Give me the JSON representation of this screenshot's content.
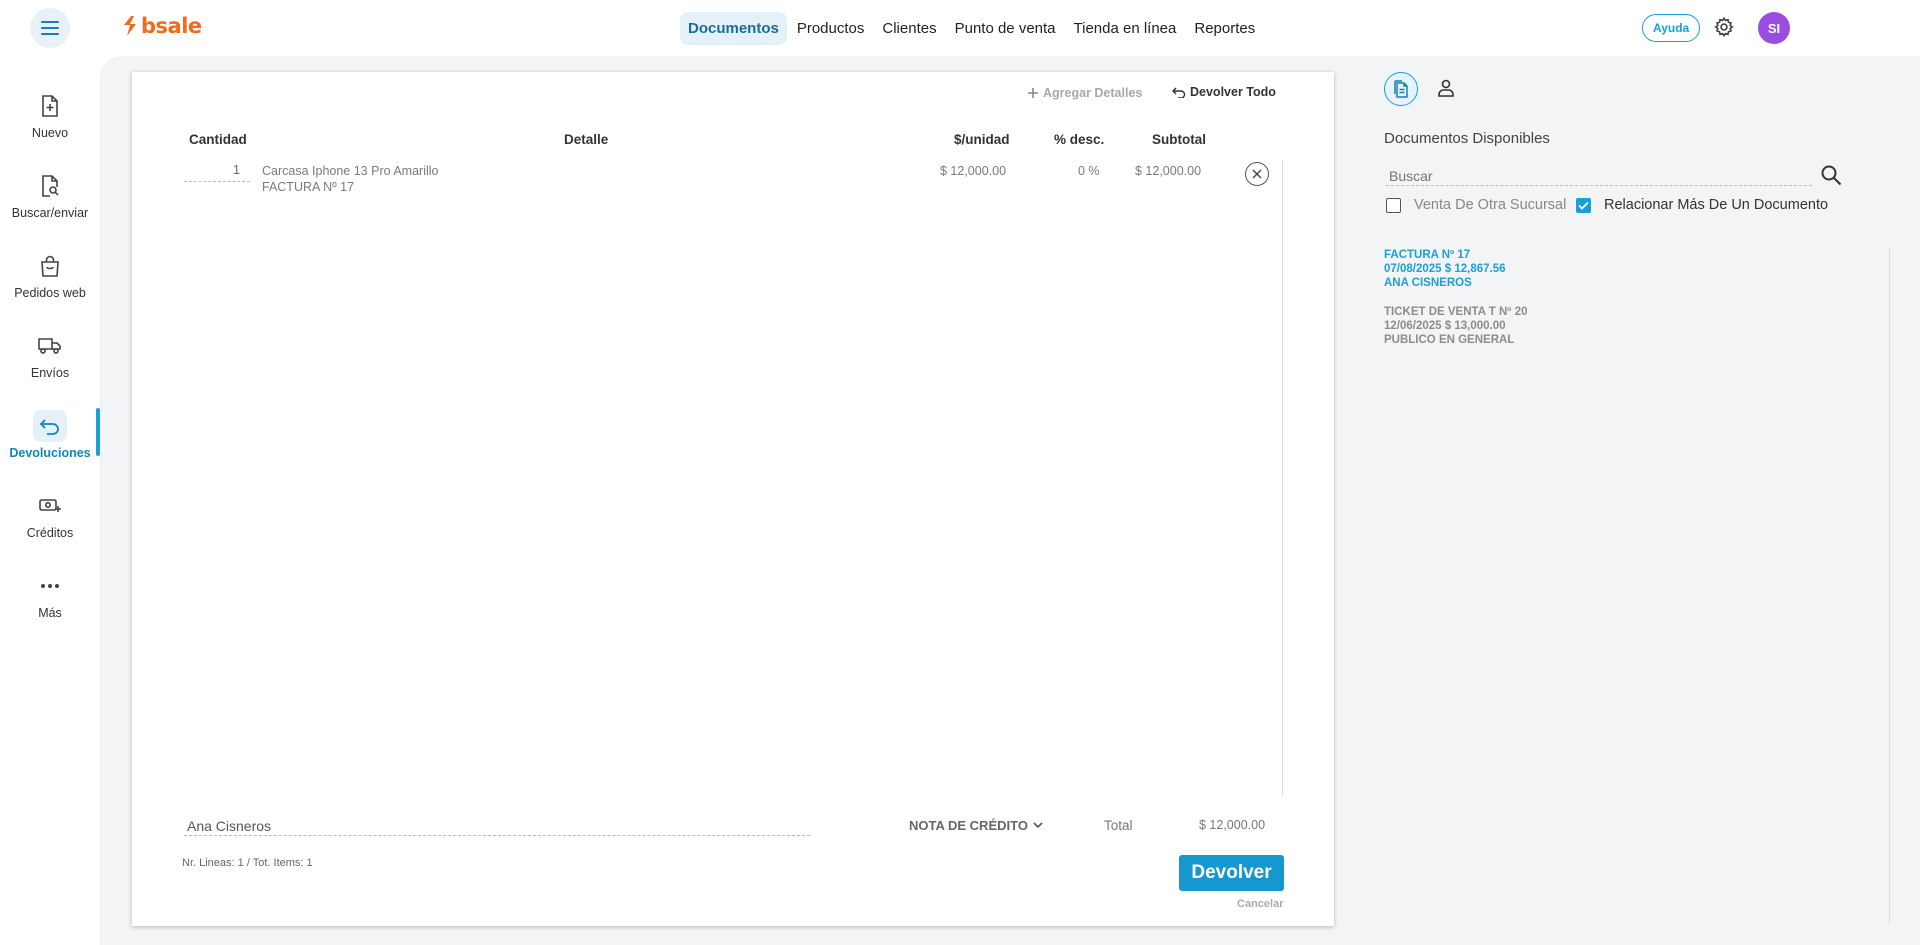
{
  "app": {
    "logo_text": "bsale",
    "brand_color": "#f26b1d",
    "accent_color": "#1a9fd6"
  },
  "topnav": {
    "items": [
      {
        "label": "Documentos",
        "active": true
      },
      {
        "label": "Productos"
      },
      {
        "label": "Clientes"
      },
      {
        "label": "Punto de venta"
      },
      {
        "label": "Tienda en línea"
      },
      {
        "label": "Reportes"
      }
    ],
    "help_label": "Ayuda",
    "avatar_initials": "SI",
    "avatar_color": "#9b4de2"
  },
  "sidebar": {
    "items": [
      {
        "label": "Nuevo",
        "icon": "file-plus-icon"
      },
      {
        "label": "Buscar/enviar",
        "icon": "file-search-icon"
      },
      {
        "label": "Pedidos web",
        "icon": "shopping-bag-icon"
      },
      {
        "label": "Envíos",
        "icon": "truck-icon"
      },
      {
        "label": "Devoluciones",
        "icon": "return-arrow-icon",
        "active": true
      },
      {
        "label": "Créditos",
        "icon": "credit-cash-icon"
      },
      {
        "label": "Más",
        "icon": "more-dots-icon"
      }
    ]
  },
  "document": {
    "add_details_label": "Agregar Detalles",
    "return_all_label": "Devolver Todo",
    "columns": {
      "quantity": "Cantidad",
      "detail": "Detalle",
      "unit_price": "$/unidad",
      "discount": "% desc.",
      "subtotal": "Subtotal"
    },
    "rows": [
      {
        "quantity": "1",
        "detail": "Carcasa Iphone 13 Pro Amarillo",
        "detail_sub": "FACTURA Nº 17",
        "unit_price": "$ 12,000.00",
        "discount": "0 %",
        "subtotal": "$ 12,000.00"
      }
    ],
    "client_name": "Ana Cisneros",
    "doc_type": "NOTA DE CRÉDITO",
    "total_label": "Total",
    "total_value": "$ 12,000.00",
    "lines_info": "Nr. Lineas: 1 / Tot. Items: 1",
    "submit_label": "Devolver",
    "cancel_label": "Cancelar"
  },
  "right_panel": {
    "title": "Documentos Disponibles",
    "search_placeholder": "Buscar",
    "checkbox_other_branch": {
      "label": "Venta De Otra Sucursal",
      "checked": false
    },
    "checkbox_multi_doc": {
      "label": "Relacionar Más De Un Documento",
      "checked": true
    },
    "documents": [
      {
        "line1": "FACTURA Nº 17",
        "line2": "07/08/2025 $ 12,867.56",
        "line3": "ANA CISNEROS",
        "selected": true
      },
      {
        "line1": "TICKET DE VENTA T Nº 20",
        "line2": "12/06/2025 $ 13,000.00",
        "line3": "PUBLICO EN GENERAL",
        "selected": false
      }
    ]
  }
}
